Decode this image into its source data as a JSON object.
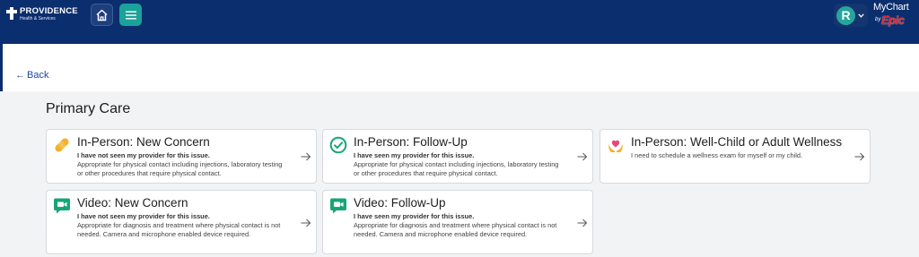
{
  "header": {
    "brand_name": "PROVIDENCE",
    "brand_sub": "Health & Services",
    "avatar_initial": "R",
    "mychart_text": "MyChart",
    "by_text": "by",
    "epic_text": "Epic"
  },
  "nav": {
    "back_label": "Back"
  },
  "section": {
    "title": "Primary Care"
  },
  "cards": [
    {
      "title": "In-Person: New Concern",
      "line1": "I have not seen my provider for this issue.",
      "line2": "Appropriate for physical contact including injections, laboratory testing or other procedures that require physical contact.",
      "icon": "bandage-icon"
    },
    {
      "title": "In-Person: Follow-Up",
      "line1": "I have seen my provider for this issue.",
      "line2": "Appropriate for physical contact including injections, laboratory testing or other procedures that require physical contact.",
      "icon": "check-circle-icon"
    },
    {
      "title": "In-Person: Well-Child or Adult Wellness",
      "line1": "I need to schedule a wellness exam for myself or my child.",
      "line2": "",
      "icon": "heart-hands-icon"
    },
    {
      "title": "Video: New Concern",
      "line1": "I have not seen my provider for this issue.",
      "line2": "Appropriate for diagnosis and treatment where physical contact is not needed. Camera and microphone enabled device required.",
      "icon": "video-chat-icon"
    },
    {
      "title": "Video: Follow-Up",
      "line1": "I have seen my provider for this issue.",
      "line2": "Appropriate for diagnosis and treatment where physical contact is not needed. Camera and microphone enabled device required.",
      "icon": "video-chat-icon"
    }
  ],
  "colors": {
    "header_bg": "#0a2e6e",
    "accent_teal": "#1aa39a",
    "link_blue": "#1b4aa0",
    "page_bg": "#f2f3f5"
  }
}
